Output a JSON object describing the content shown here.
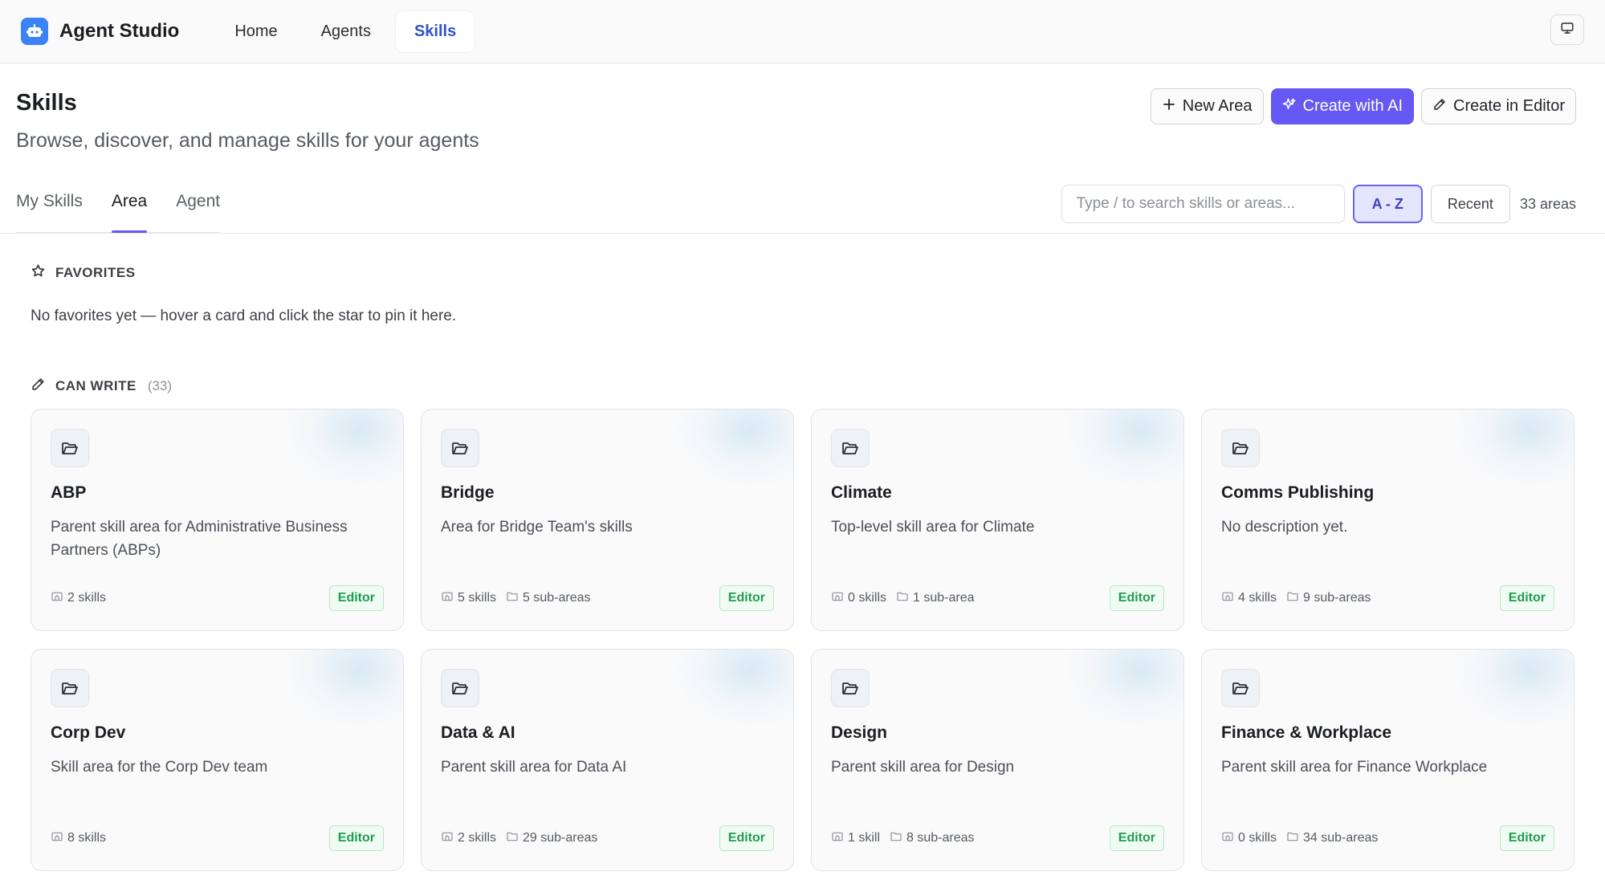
{
  "app": {
    "title": "Agent Studio"
  },
  "nav": [
    {
      "label": "Home",
      "active": false
    },
    {
      "label": "Agents",
      "active": false
    },
    {
      "label": "Skills",
      "active": true
    }
  ],
  "header": {
    "title": "Skills",
    "subtitle": "Browse, discover, and manage skills for your agents",
    "new_area": "New Area",
    "create_ai": "Create with AI",
    "create_editor": "Create in Editor"
  },
  "tabs": [
    {
      "label": "My Skills",
      "active": false
    },
    {
      "label": "Area",
      "active": true
    },
    {
      "label": "Agent",
      "active": false
    }
  ],
  "search": {
    "placeholder": "Type / to search skills or areas...",
    "value": ""
  },
  "sort": {
    "az": "A - Z",
    "recent": "Recent",
    "selected": "A - Z"
  },
  "areas_count": "33 areas",
  "favorites": {
    "title": "FAVORITES",
    "empty": "No favorites yet — hover a card and click the star to pin it here."
  },
  "can_write": {
    "title": "CAN WRITE",
    "count": "(33)"
  },
  "cards": [
    {
      "title": "ABP",
      "desc": "Parent skill area for Administrative Business Partners (ABPs)",
      "skills": "2 skills",
      "subareas": "",
      "badge": "Editor"
    },
    {
      "title": "Bridge",
      "desc": "Area for Bridge Team's skills",
      "skills": "5 skills",
      "subareas": "5 sub-areas",
      "badge": "Editor"
    },
    {
      "title": "Climate",
      "desc": "Top-level skill area for Climate",
      "skills": "0 skills",
      "subareas": "1 sub-area",
      "badge": "Editor"
    },
    {
      "title": "Comms Publishing",
      "desc": "No description yet.",
      "skills": "4 skills",
      "subareas": "9 sub-areas",
      "badge": "Editor"
    },
    {
      "title": "Corp Dev",
      "desc": "Skill area for the Corp Dev team",
      "skills": "8 skills",
      "subareas": "",
      "badge": "Editor"
    },
    {
      "title": "Data & AI",
      "desc": "Parent skill area for Data AI",
      "skills": "2 skills",
      "subareas": "29 sub-areas",
      "badge": "Editor"
    },
    {
      "title": "Design",
      "desc": "Parent skill area for Design",
      "skills": "1 skill",
      "subareas": "8 sub-areas",
      "badge": "Editor"
    },
    {
      "title": "Finance & Workplace",
      "desc": "Parent skill area for Finance Workplace",
      "skills": "0 skills",
      "subareas": "34 sub-areas",
      "badge": "Editor"
    }
  ],
  "colors": {
    "accent": "#6558f5",
    "nav_active": "#2f55c9",
    "badge_green": "#1f9d4f",
    "logo_blue": "#3b82f6"
  },
  "icons": {
    "logo": "robot-icon",
    "monitor": "monitor-icon",
    "folder": "folder-open-icon",
    "skill": "skill-icon",
    "subarea": "folder-icon",
    "star": "star-icon",
    "pencil": "pencil-icon",
    "sparkle": "sparkle-icon",
    "plus": "plus-icon"
  }
}
